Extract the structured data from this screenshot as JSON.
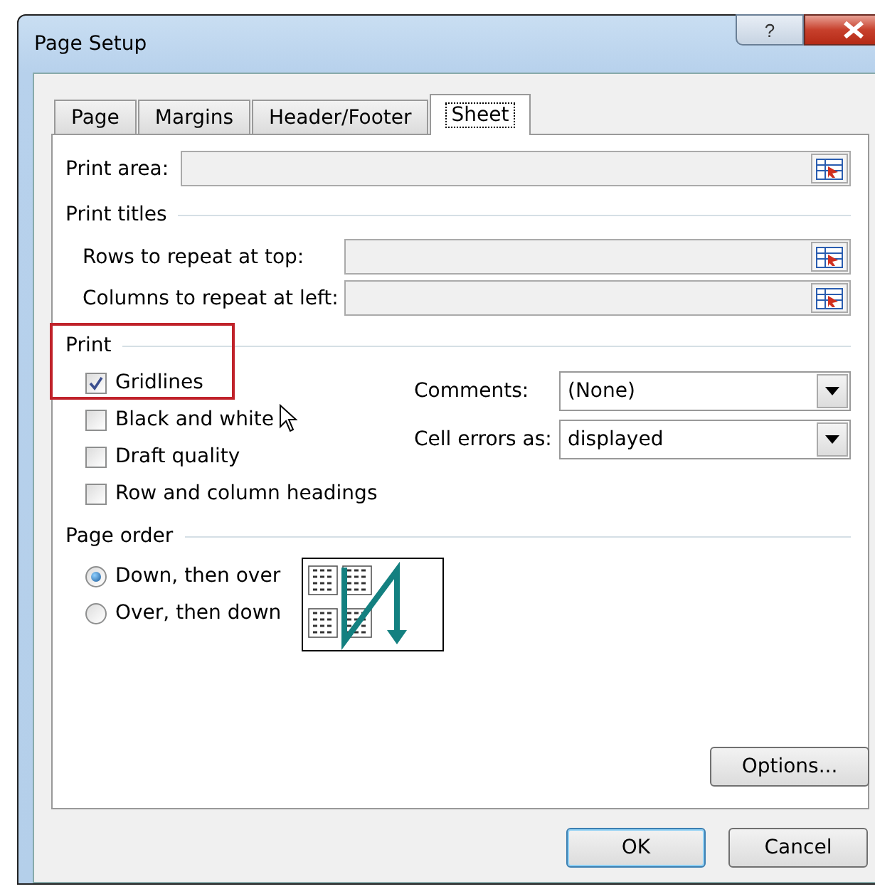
{
  "window": {
    "title": "Page Setup",
    "help": "?"
  },
  "tabs": [
    {
      "label": "Page",
      "selected": false
    },
    {
      "label": "Margins",
      "selected": false
    },
    {
      "label": "Header/Footer",
      "selected": false
    },
    {
      "label": "Sheet",
      "selected": true
    }
  ],
  "print_area": {
    "label": "Print area:"
  },
  "print_titles": {
    "heading": "Print titles",
    "fields": [
      {
        "label": "Rows to repeat at top:"
      },
      {
        "label": "Columns to repeat at left:"
      }
    ]
  },
  "print": {
    "heading": "Print",
    "options": [
      {
        "label": "Gridlines",
        "checked": true
      },
      {
        "label": "Black and white",
        "checked": false
      },
      {
        "label": "Draft quality",
        "checked": false
      },
      {
        "label": "Row and column headings",
        "checked": false
      }
    ],
    "dropdowns": [
      {
        "label": "Comments:",
        "value": "(None)"
      },
      {
        "label": "Cell errors as:",
        "value": "displayed"
      }
    ]
  },
  "page_order": {
    "heading": "Page order",
    "options": [
      {
        "label": "Down, then over",
        "selected": true
      },
      {
        "label": "Over, then down",
        "selected": false
      }
    ]
  },
  "options_button": "Options...",
  "buttons": [
    {
      "label": "OK",
      "default": true
    },
    {
      "label": "Cancel",
      "default": false
    }
  ]
}
